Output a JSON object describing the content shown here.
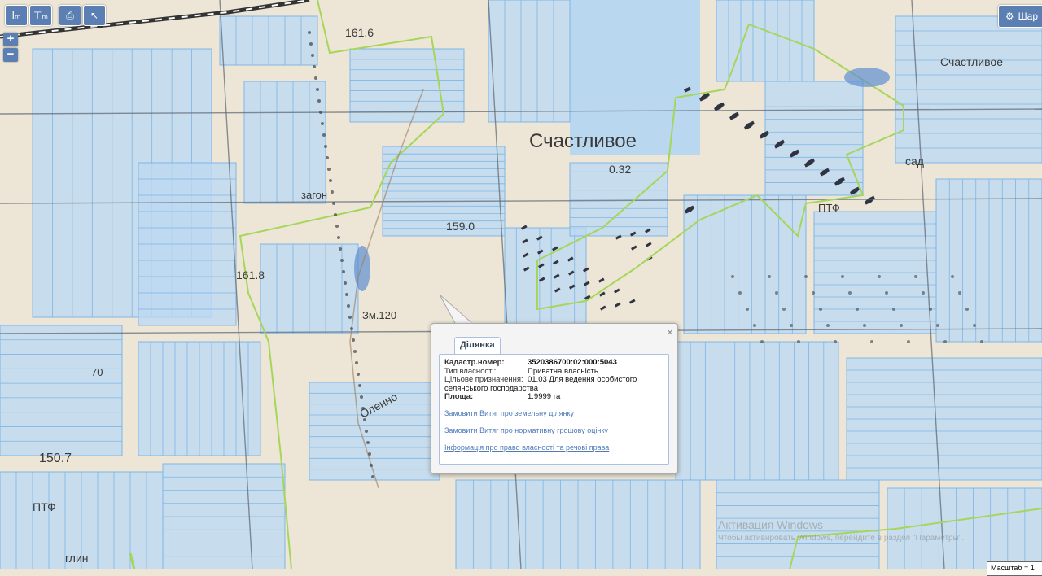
{
  "toolbar": {
    "buttons": [
      {
        "icon": "ruler-icon",
        "glyph": "Iₘ"
      },
      {
        "icon": "area-measure-icon",
        "glyph": "⊤ₘ"
      },
      {
        "icon": "printer-icon",
        "glyph": "⎙"
      },
      {
        "icon": "select-pointer-icon",
        "glyph": "↖"
      }
    ]
  },
  "zoom": {
    "in_label": "+",
    "out_label": "−"
  },
  "layers_button": {
    "label": "Шар",
    "icon": "gear-icon"
  },
  "map": {
    "labels": [
      {
        "text": "Счастливое",
        "size": "large"
      },
      {
        "text": "0.32",
        "size": "small"
      },
      {
        "text": "загон",
        "size": "small"
      },
      {
        "text": "159.0",
        "size": "small"
      },
      {
        "text": "161.6",
        "size": "small"
      },
      {
        "text": "161.8",
        "size": "small"
      },
      {
        "text": "150.7",
        "size": "small"
      },
      {
        "text": "ПТФ",
        "size": "small"
      },
      {
        "text": "Счастливое",
        "size": "small"
      },
      {
        "text": "сад",
        "size": "small"
      },
      {
        "text": "ПТФ",
        "size": "small"
      },
      {
        "text": "Оленно",
        "size": "small"
      },
      {
        "text": "Зм.120",
        "size": "small"
      },
      {
        "text": "70",
        "size": "small"
      },
      {
        "text": "глин",
        "size": "small"
      }
    ],
    "colors": {
      "parcel_fill": "#bcd9f2",
      "parcel_stroke": "#7eb6e6",
      "boundary": "#a5d65a",
      "grid": "#5a6470",
      "background": "#ede6d6"
    }
  },
  "popup": {
    "tab_label": "Ділянка",
    "close_label": "×",
    "fields": [
      {
        "key": "Кадастр.номер:",
        "value": "3520386700:02:000:5043",
        "bold": true
      },
      {
        "key": "Тип власності:",
        "value": "Приватна власність",
        "bold": false
      },
      {
        "key": "Цільове призначення:",
        "value": "01.03 Для ведення особистого селянського господарства",
        "bold": false
      },
      {
        "key": "Площа:",
        "value": "1.9999 га",
        "bold": false
      }
    ],
    "links": [
      "Замовити Витяг про земельну ділянку",
      "Замовити Витяг про нормативну грошову оцінку",
      "Інформація про право власності та речові права"
    ]
  },
  "watermark": {
    "line1": "Активация Windows",
    "line2": "Чтобы активировать Windows, перейдите в раздел \"Параметры\"."
  },
  "scale": {
    "label": "Масштаб = 1"
  }
}
